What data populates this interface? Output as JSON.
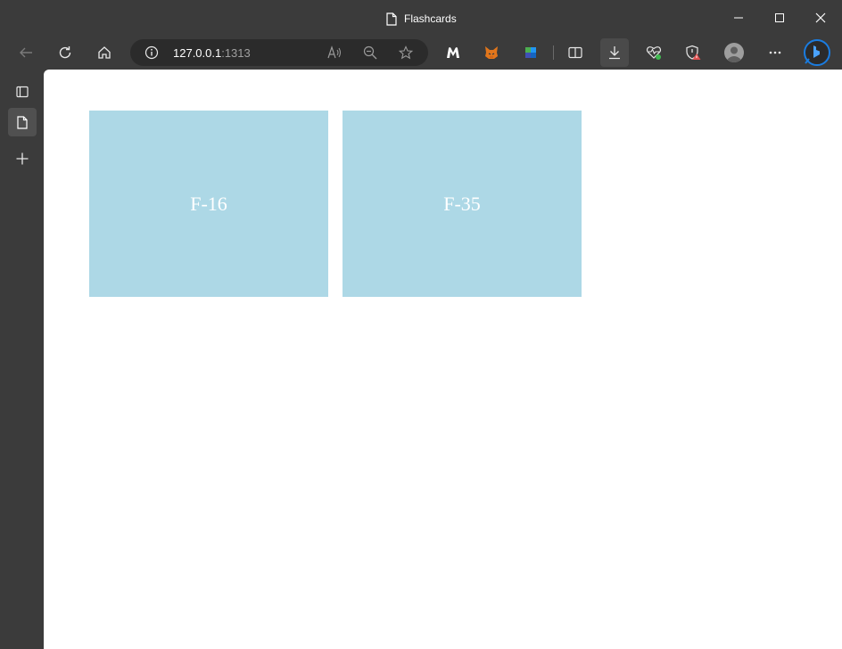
{
  "window": {
    "title": "Flashcards",
    "controls": {
      "minimize": "minimize",
      "maximize": "maximize",
      "close": "close"
    }
  },
  "toolbar": {
    "address": {
      "host": "127.0.0.1",
      "port": ":1313"
    }
  },
  "cards": [
    {
      "label": "F-16"
    },
    {
      "label": "F-35"
    }
  ],
  "colors": {
    "card_background": "#add8e6",
    "card_text": "#ffffff",
    "chrome": "#3b3b3b"
  }
}
